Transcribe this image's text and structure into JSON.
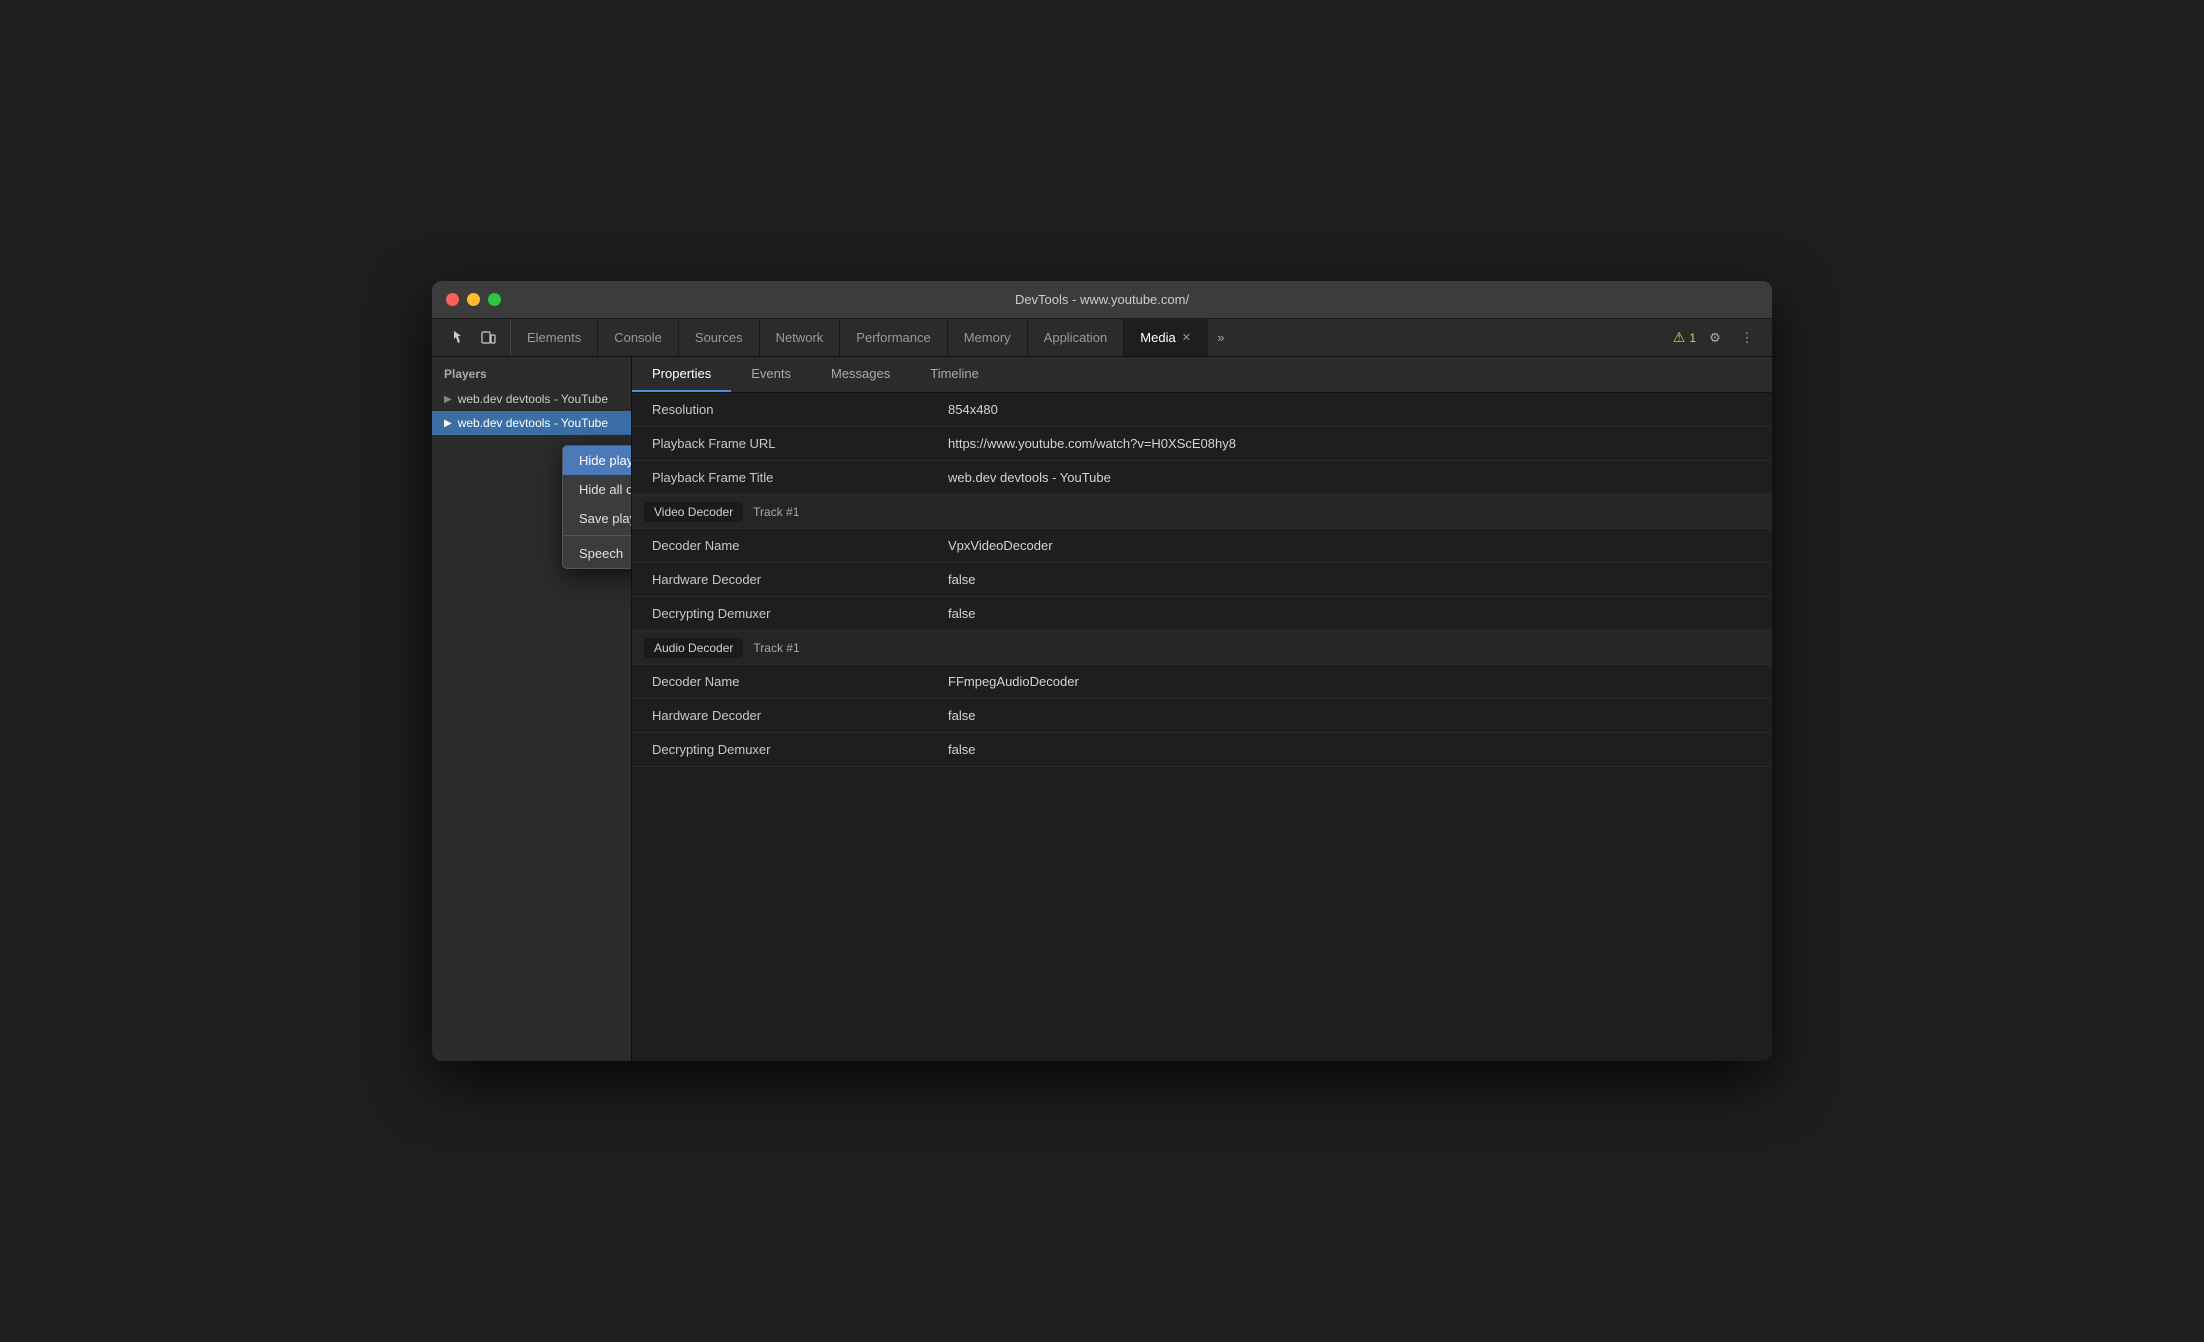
{
  "window": {
    "title": "DevTools - www.youtube.com/"
  },
  "toolbar": {
    "tabs": [
      {
        "id": "elements",
        "label": "Elements",
        "active": false
      },
      {
        "id": "console",
        "label": "Console",
        "active": false
      },
      {
        "id": "sources",
        "label": "Sources",
        "active": false
      },
      {
        "id": "network",
        "label": "Network",
        "active": false
      },
      {
        "id": "performance",
        "label": "Performance",
        "active": false
      },
      {
        "id": "memory",
        "label": "Memory",
        "active": false
      },
      {
        "id": "application",
        "label": "Application",
        "active": false
      },
      {
        "id": "media",
        "label": "Media",
        "active": true
      }
    ],
    "warning_count": "1",
    "more_tabs_label": "»"
  },
  "sidebar": {
    "header": "Players",
    "players": [
      {
        "id": "player1",
        "label": "web.dev devtools - YouTube",
        "selected": false
      },
      {
        "id": "player2",
        "label": "web.dev devtools - YouTube",
        "selected": true
      }
    ]
  },
  "context_menu": {
    "items": [
      {
        "id": "hide-player",
        "label": "Hide player",
        "highlighted": true
      },
      {
        "id": "hide-all-others",
        "label": "Hide all others"
      },
      {
        "id": "save-player-info",
        "label": "Save player info"
      },
      {
        "id": "speech",
        "label": "Speech",
        "has_submenu": true
      }
    ]
  },
  "sub_tabs": [
    {
      "id": "properties",
      "label": "Properties",
      "active": true
    },
    {
      "id": "events",
      "label": "Events",
      "active": false
    },
    {
      "id": "messages",
      "label": "Messages",
      "active": false
    },
    {
      "id": "timeline",
      "label": "Timeline",
      "active": false
    }
  ],
  "properties": {
    "rows": [
      {
        "key": "Resolution",
        "value": "854x480"
      },
      {
        "key": "Playback Frame URL",
        "value": "https://www.youtube.com/watch?v=H0XScE08hy8"
      },
      {
        "key": "Playback Frame Title",
        "value": "web.dev devtools - YouTube"
      }
    ],
    "video_decoder": {
      "title": "Video Decoder",
      "track": "Track #1",
      "rows": [
        {
          "key": "Decoder Name",
          "value": "VpxVideoDecoder"
        },
        {
          "key": "Hardware Decoder",
          "value": "false"
        },
        {
          "key": "Decrypting Demuxer",
          "value": "false"
        }
      ]
    },
    "audio_decoder": {
      "title": "Audio Decoder",
      "track": "Track #1",
      "rows": [
        {
          "key": "Decoder Name",
          "value": "FFmpegAudioDecoder"
        },
        {
          "key": "Hardware Decoder",
          "value": "false"
        },
        {
          "key": "Decrypting Demuxer",
          "value": "false"
        }
      ]
    }
  }
}
